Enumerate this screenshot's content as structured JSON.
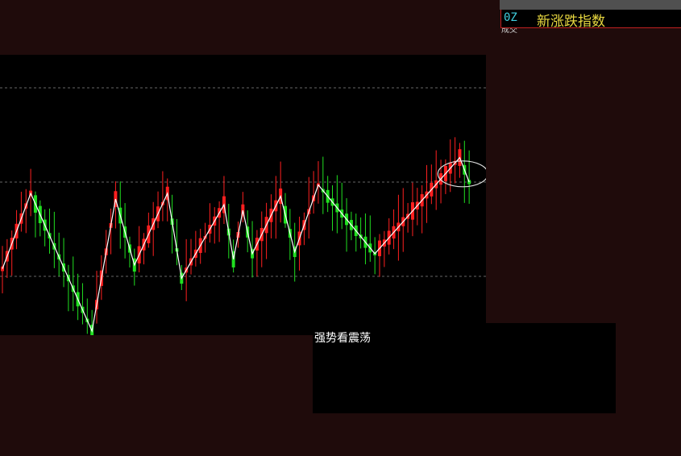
{
  "indicator": {
    "code": "0Z",
    "name": "新涨跌指数",
    "sub_label": "成交"
  },
  "note": {
    "text": "强势看震荡"
  },
  "colors": {
    "background": "#1f0b0b",
    "panel": "#000000",
    "up": "#ff2020",
    "down": "#20e020",
    "zigzag": "#ffffff",
    "gridline": "#666666",
    "highlight_ellipse": "#e0e0e0"
  },
  "chart_data": {
    "type": "candlestick",
    "count": 100,
    "y_range": [
      -1.2,
      1.4
    ],
    "gridlines": [
      1.0,
      0.0,
      -1.0
    ],
    "zigzag": [
      {
        "i": 0,
        "v": -0.92
      },
      {
        "i": 6,
        "v": -0.12
      },
      {
        "i": 19,
        "v": -1.58
      },
      {
        "i": 24,
        "v": -0.18
      },
      {
        "i": 28,
        "v": -0.88
      },
      {
        "i": 35,
        "v": -0.12
      },
      {
        "i": 38,
        "v": -1.02
      },
      {
        "i": 47,
        "v": -0.24
      },
      {
        "i": 49,
        "v": -0.82
      },
      {
        "i": 51,
        "v": -0.3
      },
      {
        "i": 53,
        "v": -0.76
      },
      {
        "i": 59,
        "v": -0.15
      },
      {
        "i": 62,
        "v": -0.74
      },
      {
        "i": 67,
        "v": -0.03
      },
      {
        "i": 79,
        "v": -0.76
      },
      {
        "i": 97,
        "v": 0.26
      },
      {
        "i": 99,
        "v": 0.0
      }
    ],
    "highlight": {
      "i": 98,
      "v": 0.13
    }
  }
}
